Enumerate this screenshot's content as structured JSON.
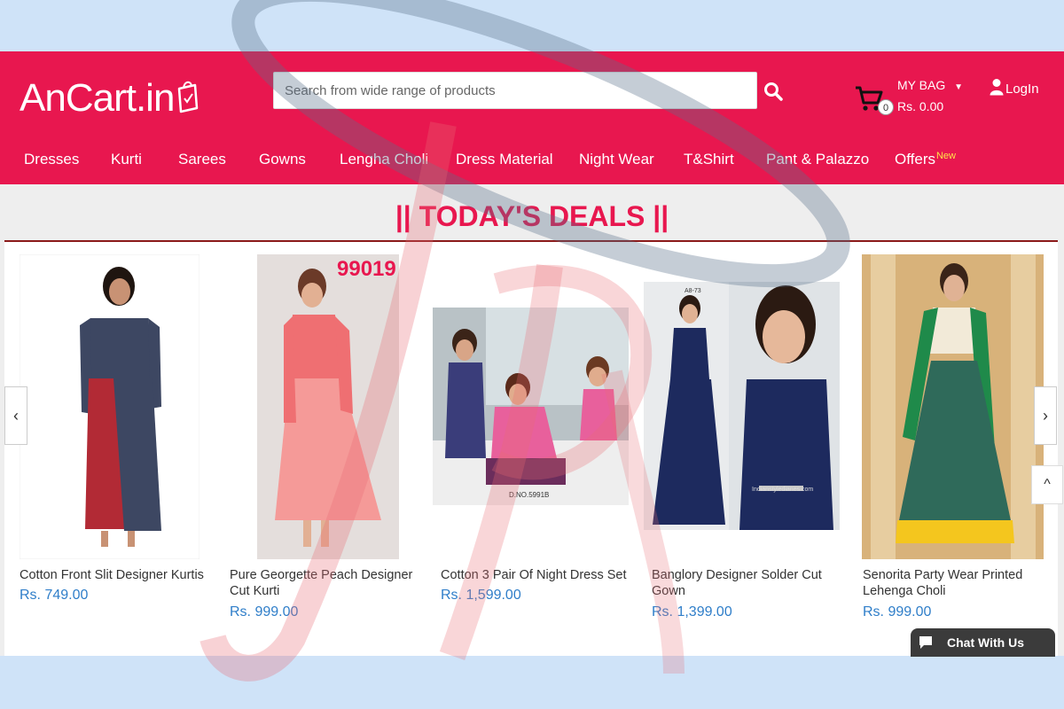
{
  "brand": {
    "logo_text": "AnCart.in",
    "primary_color": "#e8174f",
    "price_color": "#2f7ec9"
  },
  "search": {
    "placeholder": "Search from wide range of products",
    "icon": "search-icon"
  },
  "cart": {
    "count": "0",
    "label": "MY BAG",
    "caret": "▼",
    "amount": "Rs. 0.00"
  },
  "account": {
    "login_label": "LogIn"
  },
  "nav": {
    "items": [
      {
        "label": "Dresses"
      },
      {
        "label": "Kurti"
      },
      {
        "label": "Sarees"
      },
      {
        "label": "Gowns"
      },
      {
        "label": "Lengha Choli"
      },
      {
        "label": "Dress Material"
      },
      {
        "label": "Night Wear"
      },
      {
        "label": "T&Shirt"
      },
      {
        "label": "Pant & Palazzo"
      },
      {
        "label": "Offers",
        "badge": "New"
      }
    ]
  },
  "deals": {
    "title": "|| TODAY'S DEALS ||",
    "products": [
      {
        "name": "Cotton Front Slit Designer Kurtis",
        "price": "Rs. 749.00"
      },
      {
        "name": "Pure Georgette Peach Designer Cut Kurti",
        "price": "Rs. 999.00",
        "image_label": "99019"
      },
      {
        "name": "Cotton 3 Pair Of Night Dress Set",
        "price": "Rs. 1,599.00",
        "image_label": "D.NO.5991B"
      },
      {
        "name": "Banglory Designer Solder Cut Gown",
        "price": "Rs. 1,399.00",
        "image_label": "A8-73",
        "image_caption": "Indianstyledianes.com"
      },
      {
        "name": "Senorita Party Wear Printed Lehenga Choli",
        "price": "Rs. 999.00"
      }
    ]
  },
  "carousel": {
    "prev": "‹",
    "next": "›",
    "scroll_top": "^"
  },
  "chat": {
    "label": "Chat With Us"
  }
}
